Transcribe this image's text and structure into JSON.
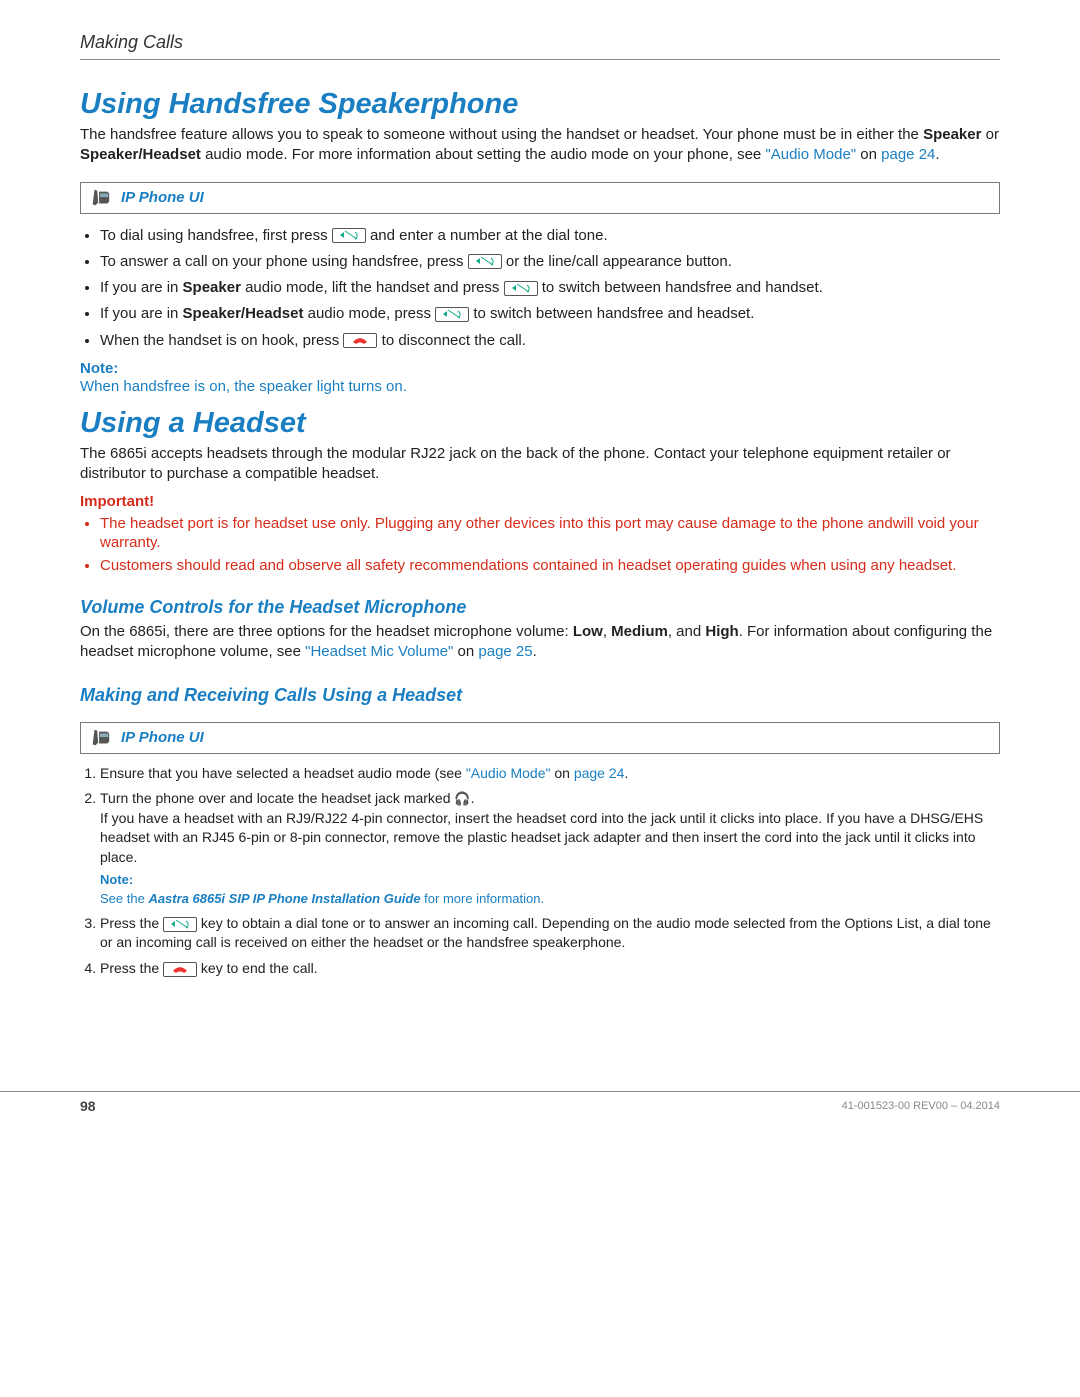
{
  "chapter": "Making Calls",
  "h1_speaker": "Using Handsfree Speakerphone",
  "p_speaker_intro_a": "The handsfree feature allows you to speak to someone without using the handset or headset. Your phone must be in either the ",
  "p_speaker_intro_b": "Speaker",
  "p_speaker_intro_c": " or ",
  "p_speaker_intro_d": "Speaker/Headset",
  "p_speaker_intro_e": " audio mode. For more information about setting the audio mode on your phone, see ",
  "p_speaker_link1": "\"Audio Mode\"",
  "p_speaker_on": " on ",
  "p_speaker_link2": "page 24",
  "period": ".",
  "banner_label": "IP Phone UI",
  "bullets_speaker": {
    "b1a": "To dial using handsfree, first press ",
    "b1b": " and enter a number at the dial tone.",
    "b2a": "To answer a call on your phone using handsfree, press ",
    "b2b": " or the line/call appearance button.",
    "b3a": "If you are in ",
    "b3bold": "Speaker",
    "b3b": " audio mode, lift the handset and press ",
    "b3c": " to switch between handsfree and handset.",
    "b4a": "If you are in ",
    "b4bold": "Speaker/Headset",
    "b4b": " audio mode, press ",
    "b4c": " to switch between handsfree and headset.",
    "b5a": "When the handset is on hook, press ",
    "b5b": " to disconnect the call."
  },
  "note_label": "Note:",
  "note_speaker": "When handsfree is on, the speaker light turns on.",
  "h1_headset": "Using a Headset",
  "p_headset_intro": "The 6865i accepts headsets through the modular RJ22 jack on the back of the phone. Contact your telephone equipment retailer or distributor to purchase a compatible headset.",
  "important_label": "Important!",
  "important_bullets": {
    "i1": "The headset port is for headset use only. Plugging any other devices into this port may cause damage to the phone andwill void your warranty.",
    "i2": "Customers should read and observe all safety recommendations contained in headset operating guides when using any headset."
  },
  "h2_volume": "Volume Controls for the Headset Microphone",
  "p_volume_a": "On the 6865i, there are three options for the headset microphone volume: ",
  "low": "Low",
  "sep": ", ",
  "med": "Medium",
  "and": ", and ",
  "high": "High",
  "p_volume_b": ". For information about configuring the headset microphone volume, see ",
  "vol_link1": "\"Headset Mic Volume\"",
  "vol_link2": "page 25",
  "h2_making": "Making and Receiving Calls Using a Headset",
  "ol": {
    "s1a": "Ensure that you have selected a headset audio mode (see ",
    "s1link1": "\"Audio Mode\"",
    "s1on": " on ",
    "s1link2": "page 24",
    "s2a": "Turn the phone over and locate the headset jack marked ",
    "s2b": ".",
    "s2c": "If you have a headset with an RJ9/RJ22 4-pin connector, insert the headset cord into the jack until it clicks into place. If you have a DHSG/EHS headset with an RJ45 6-pin or 8-pin connector, remove the plastic headset jack adapter and then insert the cord into the jack until it clicks into place.",
    "s2note": "See the ",
    "s2note_bold": "Aastra 6865i SIP IP Phone Installation Guide",
    "s2note_end": " for more information.",
    "s3a": "Press the ",
    "s3b": " key to obtain a dial tone or to answer an incoming call. Depending on the audio mode selected from the Options List, a dial tone or an incoming call is received on either the headset or the handsfree speakerphone.",
    "s4a": "Press the ",
    "s4b": " key to end the call."
  },
  "page_number": "98",
  "doc_id": "41-001523-00 REV00 – 04.2014"
}
